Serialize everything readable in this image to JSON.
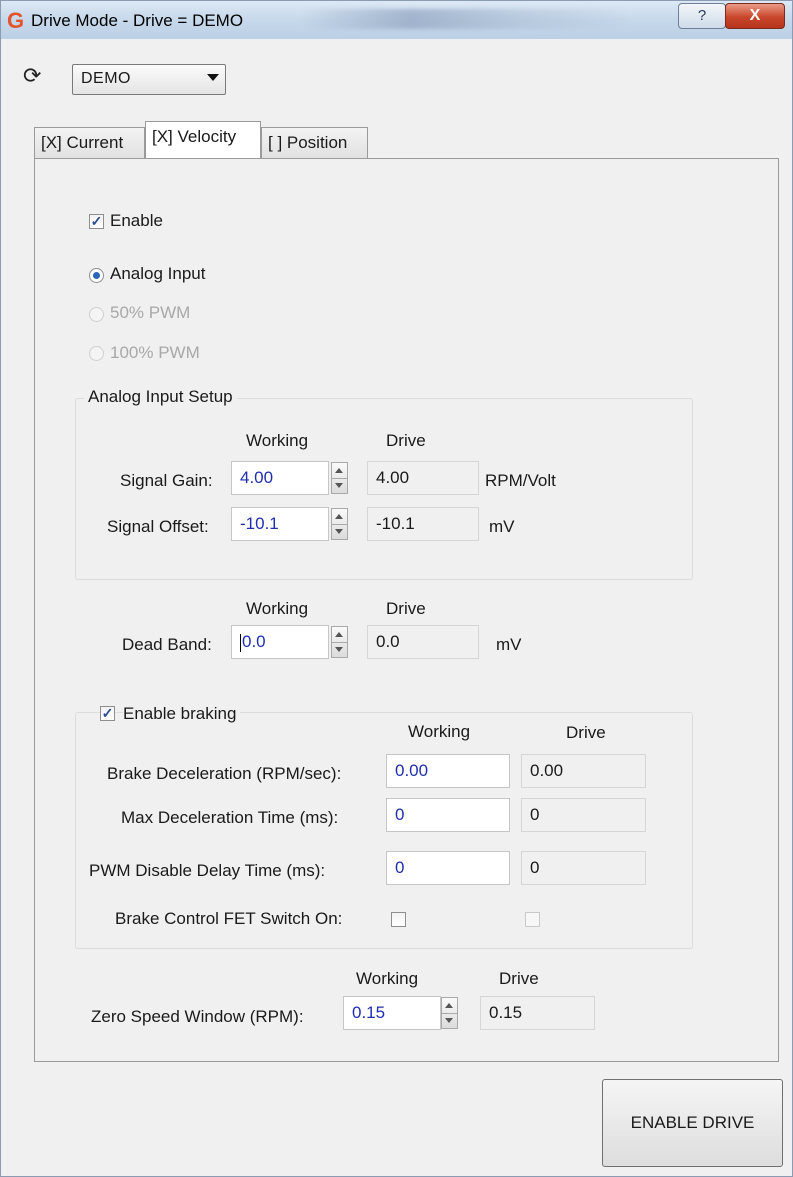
{
  "window": {
    "title": "Drive Mode - Drive = DEMO",
    "help_glyph": "?",
    "close_glyph": "X"
  },
  "drive_selector": {
    "value": "DEMO"
  },
  "tabs": [
    {
      "label": "[X] Current"
    },
    {
      "label": "[X] Velocity"
    },
    {
      "label": "[ ] Position"
    }
  ],
  "velocity": {
    "enable": {
      "label": "Enable",
      "checked": true
    },
    "modes": [
      {
        "label": "Analog Input",
        "selected": true,
        "enabled": true
      },
      {
        "label": "50% PWM",
        "selected": false,
        "enabled": false
      },
      {
        "label": "100% PWM",
        "selected": false,
        "enabled": false
      }
    ],
    "analog_setup": {
      "title": "Analog Input Setup",
      "col_working": "Working",
      "col_drive": "Drive",
      "rows": [
        {
          "label": "Signal Gain:",
          "working": "4.00",
          "drive": "4.00",
          "unit": "RPM/Volt"
        },
        {
          "label": "Signal Offset:",
          "working": "-10.1",
          "drive": "-10.1",
          "unit": "mV"
        }
      ]
    },
    "dead_band": {
      "col_working": "Working",
      "col_drive": "Drive",
      "label": "Dead Band:",
      "working": "0.0",
      "drive": "0.0",
      "unit": "mV"
    },
    "braking": {
      "label": "Enable braking",
      "checked": true,
      "col_working": "Working",
      "col_drive": "Drive",
      "rows": [
        {
          "label": "Brake Deceleration (RPM/sec):",
          "working": "0.00",
          "drive": "0.00"
        },
        {
          "label": "Max Deceleration Time (ms):",
          "working": "0",
          "drive": "0"
        },
        {
          "label": "PWM Disable Delay Time (ms):",
          "working": "0",
          "drive": "0"
        }
      ],
      "fet_switch": {
        "label": "Brake Control FET Switch On:",
        "working_checked": false,
        "drive_checked": false
      }
    },
    "zero_speed": {
      "col_working": "Working",
      "col_drive": "Drive",
      "label": "Zero Speed Window (RPM):",
      "working": "0.15",
      "drive": "0.15"
    }
  },
  "enable_drive_button": "ENABLE DRIVE"
}
